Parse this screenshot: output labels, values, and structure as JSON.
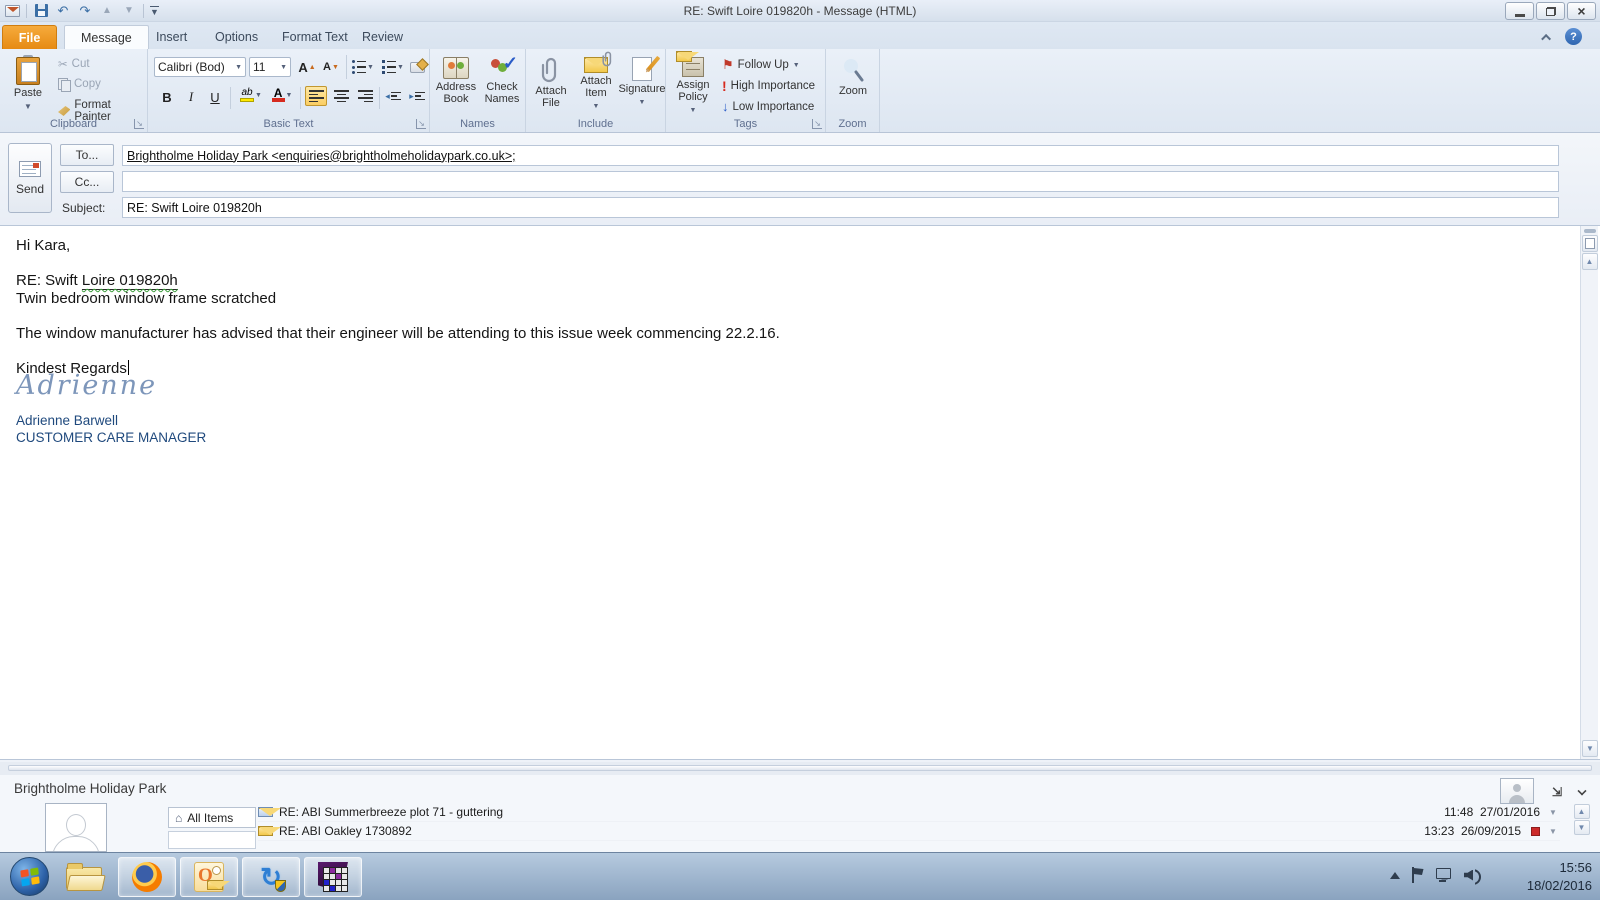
{
  "titlebar": {
    "title": "RE: Swift Loire  019820h  -  Message (HTML)"
  },
  "tabs": {
    "file": "File",
    "items": [
      {
        "label": "Message"
      },
      {
        "label": "Insert"
      },
      {
        "label": "Options"
      },
      {
        "label": "Format Text"
      },
      {
        "label": "Review"
      }
    ]
  },
  "ribbon": {
    "clipboard": {
      "label": "Clipboard",
      "paste": "Paste",
      "cut": "Cut",
      "copy": "Copy",
      "format_painter": "Format Painter"
    },
    "basic_text": {
      "label": "Basic Text",
      "font_name": "Calibri (Bod)",
      "font_size": "11",
      "bold": "B",
      "italic": "I",
      "underline": "U",
      "highlight": "ab",
      "font_color": "A",
      "grow": "A",
      "shrink": "A"
    },
    "names": {
      "label": "Names",
      "address_book": "Address Book",
      "check_names": "Check Names"
    },
    "include": {
      "label": "Include",
      "attach_file": "Attach File",
      "attach_item": "Attach Item",
      "signature": "Signature"
    },
    "tags": {
      "label": "Tags",
      "assign_policy": "Assign Policy",
      "follow_up": "Follow Up",
      "high_importance": "High Importance",
      "low_importance": "Low Importance"
    },
    "zoom": {
      "label": "Zoom",
      "button": "Zoom"
    }
  },
  "compose": {
    "send": "Send",
    "to_label": "To...",
    "cc_label": "Cc...",
    "subject_label": "Subject:",
    "to_value": "Brightholme Holiday Park <enquiries@brightholmeholidaypark.co.uk>;",
    "cc_value": "",
    "subject_value": "RE: Swift Loire  019820h"
  },
  "body": {
    "greeting": "Hi Kara,",
    "ref_plain": "RE: Swift ",
    "ref_underlined": "Loire  019820h",
    "line2": "Twin bedroom window frame scratched",
    "para": "The window manufacturer has advised that their engineer will be attending to this issue week commencing 22.2.16.",
    "closing": "Kindest Regards",
    "signature_script": "Adrienne",
    "signature_name": "Adrienne Barwell",
    "signature_title": "CUSTOMER CARE MANAGER"
  },
  "people_pane": {
    "title": "Brightholme Holiday Park",
    "tab_all_items": "All Items",
    "items": [
      {
        "subject": "RE: ABI Summerbreeze plot 71 - guttering",
        "time": "11:48",
        "date": "27/01/2016"
      },
      {
        "subject": "RE: ABI Oakley 1730892",
        "time": "13:23",
        "date": "26/09/2015"
      }
    ]
  },
  "taskbar": {
    "clock_time": "15:56",
    "clock_date": "18/02/2016"
  },
  "icons": {
    "cut": "✂",
    "check": "✓",
    "flag": "⚑",
    "high_importance": "!",
    "low_importance": "↓",
    "home": "⌂",
    "caret_down": "▼",
    "caret_up": "▲",
    "close": "×",
    "help": "?",
    "undo": "↶",
    "redo": "↷",
    "prev": "▲",
    "next": "▼",
    "sync": "↻",
    "launcher": "↘",
    "indent_left": "◂",
    "indent_right": "▸"
  }
}
